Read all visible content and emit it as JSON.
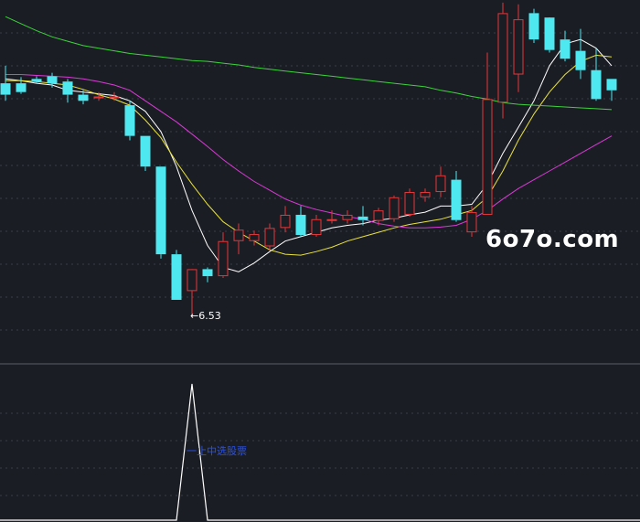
{
  "watermark": "6o7o.com",
  "colors": {
    "background": "#1b1d24",
    "grid": "#3a3d48",
    "up": "#e4373a",
    "down": "#4ee8f0",
    "ma_white": "#ffffff",
    "ma_yellow": "#e8e23a",
    "ma_magenta": "#d93ad6",
    "ma_green": "#3ad43a",
    "indicator": "#ffffff",
    "signal_text": "#2a52e8"
  },
  "chart_data": [
    {
      "type": "candlestick",
      "ylim": [
        6.0,
        10.15
      ],
      "x": [
        1,
        2,
        3,
        4,
        5,
        6,
        7,
        8,
        9,
        10,
        11,
        12,
        13,
        14,
        15,
        16,
        17,
        18,
        19,
        20,
        21,
        22,
        23,
        24,
        25,
        26,
        27,
        28,
        29,
        30,
        31,
        32,
        33,
        34,
        35,
        36,
        37,
        38,
        39,
        40
      ],
      "open": [
        9.2,
        9.2,
        9.25,
        9.28,
        9.22,
        9.07,
        9.05,
        9.05,
        8.95,
        8.6,
        8.25,
        7.25,
        6.83,
        7.08,
        7.0,
        7.4,
        7.4,
        7.34,
        7.55,
        7.7,
        7.47,
        7.65,
        7.64,
        7.68,
        7.63,
        7.65,
        7.7,
        7.9,
        7.96,
        8.1,
        7.5,
        7.7,
        8.98,
        9.3,
        10.0,
        9.95,
        9.7,
        9.57,
        9.35,
        9.25
      ],
      "close": [
        9.07,
        9.1,
        9.22,
        9.2,
        9.07,
        9.0,
        9.05,
        9.05,
        8.6,
        8.25,
        7.25,
        6.73,
        7.08,
        7.0,
        7.4,
        7.53,
        7.48,
        7.55,
        7.7,
        7.47,
        7.65,
        7.65,
        7.7,
        7.64,
        7.75,
        7.9,
        7.96,
        7.96,
        8.15,
        7.64,
        7.73,
        9.02,
        10.0,
        9.93,
        9.7,
        9.58,
        9.48,
        9.35,
        9.02,
        9.12
      ],
      "high": [
        9.4,
        9.27,
        9.28,
        9.32,
        9.25,
        9.12,
        9.1,
        9.1,
        9.0,
        8.6,
        8.25,
        7.3,
        6.9,
        7.1,
        7.5,
        7.6,
        7.52,
        7.6,
        7.8,
        7.8,
        7.7,
        7.75,
        7.75,
        7.8,
        7.78,
        7.92,
        8.0,
        8.0,
        8.25,
        8.2,
        7.8,
        9.55,
        10.12,
        10.1,
        10.05,
        9.86,
        9.8,
        9.82,
        9.6,
        9.25
      ],
      "low": [
        9.0,
        9.08,
        9.2,
        9.15,
        8.98,
        8.96,
        9.0,
        9.0,
        8.55,
        8.2,
        7.2,
        6.73,
        6.53,
        6.93,
        6.98,
        7.25,
        7.35,
        7.3,
        7.5,
        7.45,
        7.45,
        7.6,
        7.6,
        7.58,
        7.58,
        7.62,
        7.68,
        7.85,
        7.9,
        7.62,
        7.45,
        7.7,
        8.8,
        9.1,
        9.66,
        9.55,
        9.45,
        9.25,
        9.0,
        9.0
      ],
      "series": [
        {
          "key": "ma_white",
          "values": [
            9.25,
            9.23,
            9.2,
            9.18,
            9.12,
            9.1,
            9.08,
            9.06,
            9.0,
            8.88,
            8.65,
            8.25,
            7.75,
            7.35,
            7.1,
            7.05,
            7.15,
            7.28,
            7.4,
            7.45,
            7.5,
            7.55,
            7.58,
            7.6,
            7.64,
            7.66,
            7.7,
            7.73,
            7.8,
            7.8,
            7.82,
            8.05,
            8.4,
            8.7,
            9.0,
            9.4,
            9.65,
            9.7,
            9.6,
            9.4
          ]
        },
        {
          "key": "ma_yellow",
          "values": [
            9.23,
            9.23,
            9.22,
            9.2,
            9.18,
            9.13,
            9.07,
            9.02,
            8.95,
            8.78,
            8.58,
            8.3,
            8.05,
            7.82,
            7.62,
            7.5,
            7.4,
            7.3,
            7.25,
            7.24,
            7.28,
            7.33,
            7.4,
            7.45,
            7.5,
            7.55,
            7.59,
            7.62,
            7.65,
            7.7,
            7.75,
            7.9,
            8.2,
            8.55,
            8.85,
            9.1,
            9.3,
            9.45,
            9.52,
            9.5
          ]
        },
        {
          "key": "ma_magenta",
          "values": [
            9.3,
            9.3,
            9.29,
            9.28,
            9.27,
            9.25,
            9.22,
            9.18,
            9.12,
            9.0,
            8.88,
            8.76,
            8.62,
            8.48,
            8.33,
            8.2,
            8.08,
            7.98,
            7.88,
            7.81,
            7.76,
            7.72,
            7.68,
            7.65,
            7.6,
            7.57,
            7.55,
            7.55,
            7.56,
            7.58,
            7.65,
            7.75,
            7.88,
            8.0,
            8.1,
            8.2,
            8.3,
            8.4,
            8.5,
            8.6
          ]
        },
        {
          "key": "ma_green",
          "values": [
            9.96,
            9.88,
            9.8,
            9.73,
            9.68,
            9.63,
            9.6,
            9.57,
            9.54,
            9.52,
            9.5,
            9.48,
            9.46,
            9.45,
            9.43,
            9.41,
            9.38,
            9.36,
            9.34,
            9.32,
            9.3,
            9.28,
            9.26,
            9.24,
            9.22,
            9.2,
            9.18,
            9.16,
            9.12,
            9.09,
            9.05,
            9.02,
            8.98,
            8.96,
            8.95,
            8.94,
            8.93,
            8.92,
            8.91,
            8.9
          ]
        }
      ],
      "annotations": [
        {
          "x": 13,
          "y": 6.53,
          "label": "←6.53"
        }
      ]
    },
    {
      "type": "line",
      "x": [
        1,
        2,
        3,
        4,
        5,
        6,
        7,
        8,
        9,
        10,
        11,
        12,
        13,
        14,
        15,
        16,
        17,
        18,
        19,
        20,
        21,
        22,
        23,
        24,
        25,
        26,
        27,
        28,
        29,
        30,
        31,
        32,
        33,
        34,
        35,
        36,
        37,
        38,
        39,
        40
      ],
      "series": [
        {
          "key": "indicator",
          "values": [
            0,
            0,
            0,
            0,
            0,
            0,
            0,
            0,
            0,
            0,
            0,
            0,
            1,
            0,
            0,
            0,
            0,
            0,
            0,
            0,
            0,
            0,
            0,
            0,
            0,
            0,
            0,
            0,
            0,
            0,
            0,
            0,
            0,
            0,
            0,
            0,
            0,
            0,
            0,
            0
          ]
        }
      ],
      "ylim": [
        0,
        1
      ],
      "annotations": [
        {
          "x": 13,
          "y": 0.5,
          "label": "一止中选股票"
        }
      ]
    }
  ]
}
